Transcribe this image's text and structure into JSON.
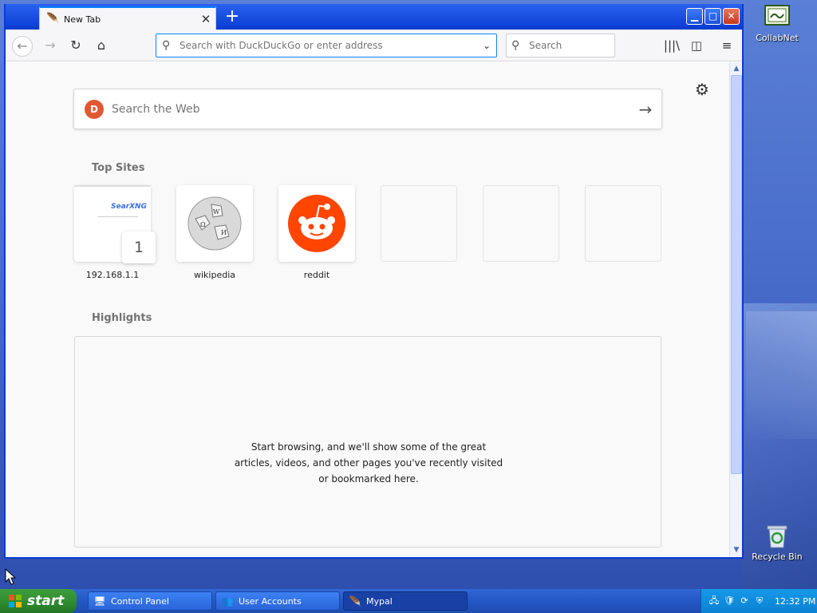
{
  "desktop": {
    "icons": [
      {
        "label": "CollabNet"
      },
      {
        "label": "Recycle Bin"
      }
    ]
  },
  "browser": {
    "tab": {
      "title": "New Tab"
    },
    "urlbar": {
      "placeholder": "Search with DuckDuckGo or enter address"
    },
    "searchbar": {
      "placeholder": "Search"
    },
    "content": {
      "websearch_placeholder": "Search the Web",
      "top_sites_title": "Top Sites",
      "top_sites": [
        {
          "label": "192.168.1.1",
          "thumb_text": "SearXNG",
          "badge": "1"
        },
        {
          "label": "wikipedia"
        },
        {
          "label": "reddit"
        }
      ],
      "highlights_title": "Highlights",
      "highlights_message": "Start browsing, and we'll show some of the great articles, videos, and other pages you've recently visited or bookmarked here."
    }
  },
  "taskbar": {
    "start_label": "start",
    "tasks": [
      {
        "label": "Control Panel"
      },
      {
        "label": "User Accounts"
      },
      {
        "label": "Mypal"
      }
    ],
    "clock": "12:32 PM"
  },
  "colors": {
    "accent": "#0a84ff",
    "xp_blue": "#0a3bd1",
    "reddit": "#ff4500",
    "ddg": "#de5833"
  }
}
